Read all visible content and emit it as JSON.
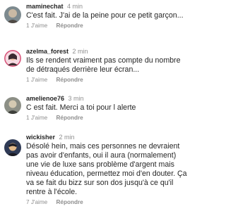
{
  "comments": [
    {
      "username": "maminechat",
      "time": "4 min",
      "lines": [
        "C'est fait. J'ai de la peine pour ce petit garçon..."
      ],
      "likes": "1 J'aime",
      "reply": "Répondre",
      "avatar_colors": [
        "#7d8a8f",
        "#c9b9a4",
        "#4f4a45"
      ]
    },
    {
      "username": "azelma_forest",
      "time": "2 min",
      "lines": [
        "Ils se rendent vraiment pas compte du nombre",
        "de détraqués derrière leur écran..."
      ],
      "likes": "1 J'aime",
      "reply": "Répondre",
      "avatar_colors": [
        "#d8547a",
        "#f2c6a8",
        "#3b2a2f"
      ]
    },
    {
      "username": "amelienoe76",
      "time": "3 min",
      "lines": [
        "C est fait. Merci a toi pour l alerte"
      ],
      "likes": "1 J'aime",
      "reply": "Répondre",
      "avatar_colors": [
        "#8c8f86",
        "#d4c9b2",
        "#3e3f3a"
      ]
    },
    {
      "username": "wickisher",
      "time": "2 min",
      "lines": [
        "Désolé hein, mais ces personnes ne devraient",
        "pas avoir d'enfants, oui il aura (normalement)",
        "une vie de luxe sans problème d'argent mais",
        "niveau éducation, permettez moi d'en douter. Ça",
        "va se fait du bizz sur son dos jusqu'à ce qu'il",
        "rentre à l'école."
      ],
      "likes": "7 J'aime",
      "reply": "Répondre",
      "avatar_colors": [
        "#2f3a55",
        "#e1b98a",
        "#1b1b22"
      ]
    }
  ]
}
